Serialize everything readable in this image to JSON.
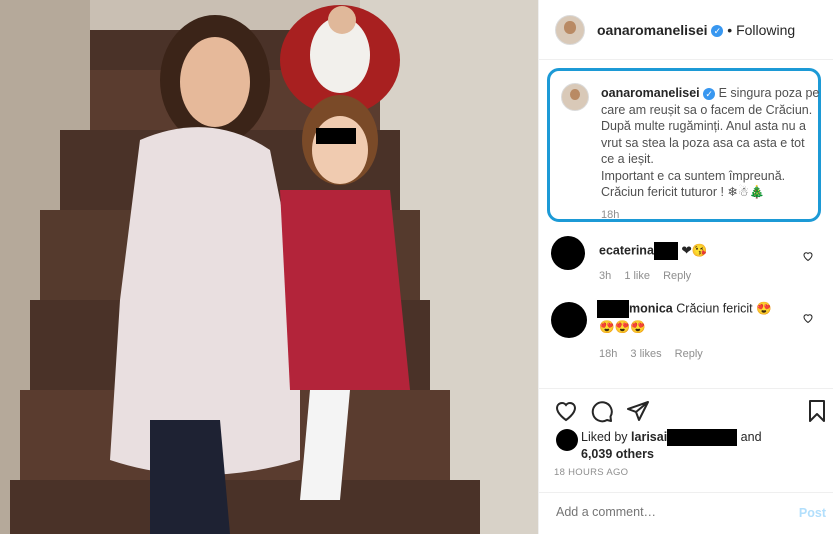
{
  "post": {
    "username": "oanaromanelisei",
    "follow_status": "Following",
    "caption": "E singura poza pe care am reușit sa o facem de Crăciun. După multe rugăminți. Anul asta nu a vrut sa stea la poza asa ca asta e tot ce a ieșit.",
    "caption_line2": "Important e ca suntem împreună.",
    "caption_line3": "Crăciun fericit tuturor ! ❄☃🎄",
    "caption_time": "18h"
  },
  "comments": [
    {
      "user": "ecaterina",
      "text": "❤😘",
      "time": "3h",
      "likes": "1 like",
      "reply": "Reply"
    },
    {
      "user": "monica",
      "text": "Crăciun fericit 😍",
      "text2": "😍😍😍",
      "time": "18h",
      "likes": "3 likes",
      "reply": "Reply"
    }
  ],
  "likes": {
    "prefix": "Liked by",
    "user": "larisai",
    "and": "and",
    "others": "6,039 others"
  },
  "timestamp": "18 HOURS AGO",
  "add_comment": {
    "placeholder": "Add a comment…",
    "post_label": "Post"
  },
  "icons": {
    "like": "heart-icon",
    "comment": "comment-icon",
    "share": "paper-plane-icon",
    "save": "bookmark-icon",
    "more": "more-icon"
  },
  "colors": {
    "highlight": "#1c9ad6",
    "verified": "#3897f0",
    "heart": "#ed4956"
  }
}
